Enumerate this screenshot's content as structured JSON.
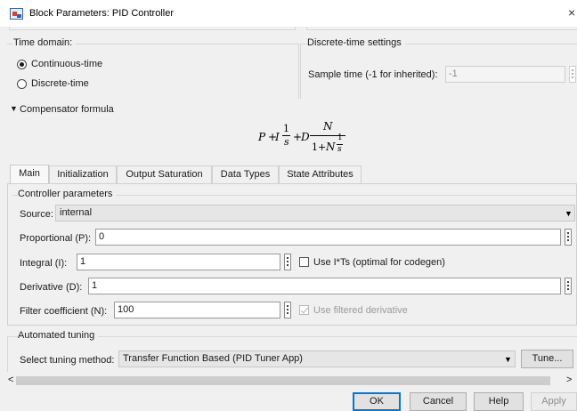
{
  "window": {
    "title": "Block Parameters: PID Controller",
    "close_glyph": "×",
    "icon": "simulink-block-icon"
  },
  "time_domain": {
    "title": "Time domain:",
    "options": [
      {
        "label": "Continuous-time",
        "selected": true
      },
      {
        "label": "Discrete-time",
        "selected": false
      }
    ]
  },
  "discrete_settings": {
    "title": "Discrete-time settings",
    "sample_time_label": "Sample time (-1 for inherited):",
    "sample_time_value": "-1"
  },
  "compensator": {
    "toggle_glyph": "▼",
    "label": "Compensator formula",
    "formula": {
      "P": "P",
      "plus1": "+",
      "I": "I",
      "one": "1",
      "s": "s",
      "plus2": "+",
      "D": "D",
      "N": "N",
      "denom_one": "1",
      "denom_plus": "+",
      "denom_N": "N",
      "inner_one": "1",
      "inner_s": "s"
    }
  },
  "tabs": [
    {
      "label": "Main",
      "active": true
    },
    {
      "label": "Initialization",
      "active": false
    },
    {
      "label": "Output Saturation",
      "active": false
    },
    {
      "label": "Data Types",
      "active": false
    },
    {
      "label": "State Attributes",
      "active": false
    }
  ],
  "controller_params": {
    "title": "Controller parameters",
    "source_label": "Source:",
    "source_value": "internal",
    "proportional_label": "Proportional (P):",
    "proportional_value": "0",
    "integral_label": "Integral (I):",
    "integral_value": "1",
    "use_its_label": "Use I*Ts (optimal for codegen)",
    "use_its_checked": false,
    "derivative_label": "Derivative (D):",
    "derivative_value": "1",
    "filter_label": "Filter coefficient (N):",
    "filter_value": "100",
    "use_filtered_label": "Use filtered derivative",
    "use_filtered_checked": true
  },
  "automated_tuning": {
    "title": "Automated tuning",
    "method_label": "Select tuning method:",
    "method_value": "Transfer Function Based (PID Tuner App)",
    "tune_button": "Tune..."
  },
  "scroll": {
    "left_glyph": "<",
    "right_glyph": ">"
  },
  "footer": {
    "ok": "OK",
    "cancel": "Cancel",
    "help": "Help",
    "apply": "Apply"
  },
  "colors": {
    "focus_border": "#0078d7",
    "background": "#f0f0f0"
  }
}
